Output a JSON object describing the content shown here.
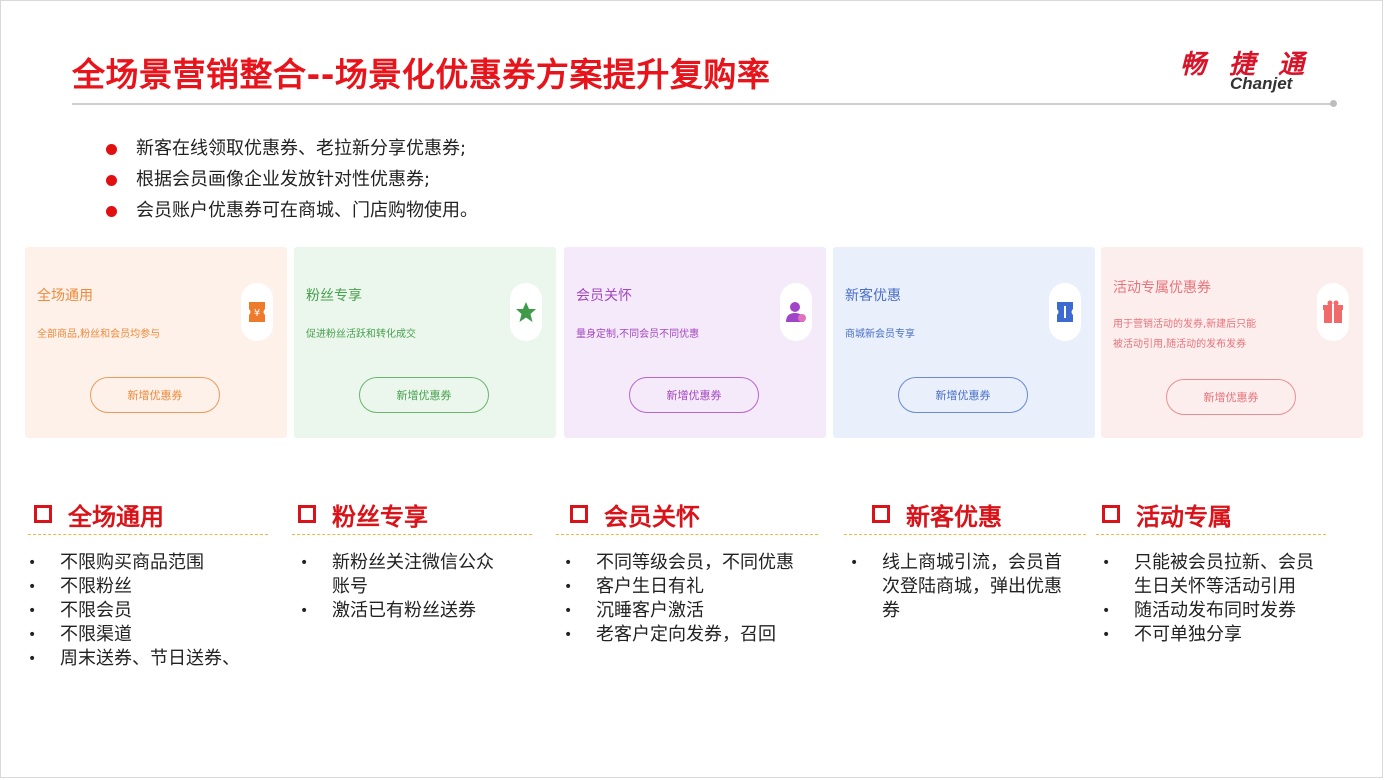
{
  "header": {
    "title": "全场景营销整合--场景化优惠券方案提升复购率",
    "logo_cn": "畅 捷 通",
    "logo_en": "Chanjet"
  },
  "bullets": [
    "新客在线领取优惠券、老拉新分享优惠券;",
    "根据会员画像企业发放针对性优惠券;",
    "会员账户优惠券可在商城、门店购物使用。"
  ],
  "cards": [
    {
      "title": "全场通用",
      "desc": "全部商品,粉丝和会员均参与",
      "button": "新增优惠券",
      "icon": "coupon-icon",
      "color": "#ee8a3c",
      "bg": "#fdf1ea"
    },
    {
      "title": "粉丝专享",
      "desc": "促进粉丝活跃和转化成交",
      "button": "新增优惠券",
      "icon": "star-icon",
      "color": "#49a04f",
      "bg": "#ebf7ec"
    },
    {
      "title": "会员关怀",
      "desc": "量身定制,不同会员不同优惠",
      "button": "新增优惠券",
      "icon": "member-icon",
      "color": "#a347c0",
      "bg": "#f5eafa"
    },
    {
      "title": "新客优惠",
      "desc": "商城新会员专享",
      "button": "新增优惠券",
      "icon": "ticket-icon",
      "color": "#4b6fc6",
      "bg": "#e9f0fc"
    },
    {
      "title": "活动专属优惠券",
      "desc": "用于营销活动的发券,新建后只能被活动引用,随活动的发布发券",
      "button": "新增优惠券",
      "icon": "gift-icon",
      "color": "#e8737a",
      "bg": "#fdeeee"
    }
  ],
  "sections": [
    {
      "title": "全场通用",
      "items": [
        "不限购买商品范围",
        "不限粉丝",
        "不限会员",
        "不限渠道",
        "周末送券、节日送券、"
      ]
    },
    {
      "title": "粉丝专享",
      "items": [
        "新粉丝关注微信公众账号",
        "激活已有粉丝送券"
      ]
    },
    {
      "title": "会员关怀",
      "items": [
        "不同等级会员，不同优惠",
        "客户生日有礼",
        "沉睡客户激活",
        "老客户定向发券，召回"
      ]
    },
    {
      "title": "新客优惠",
      "items": [
        "线上商城引流，会员首次登陆商城，弹出优惠券"
      ]
    },
    {
      "title": "活动专属",
      "items": [
        "只能被会员拉新、会员生日关怀等活动引用",
        "随活动发布同时发券",
        "不可单独分享"
      ]
    }
  ]
}
